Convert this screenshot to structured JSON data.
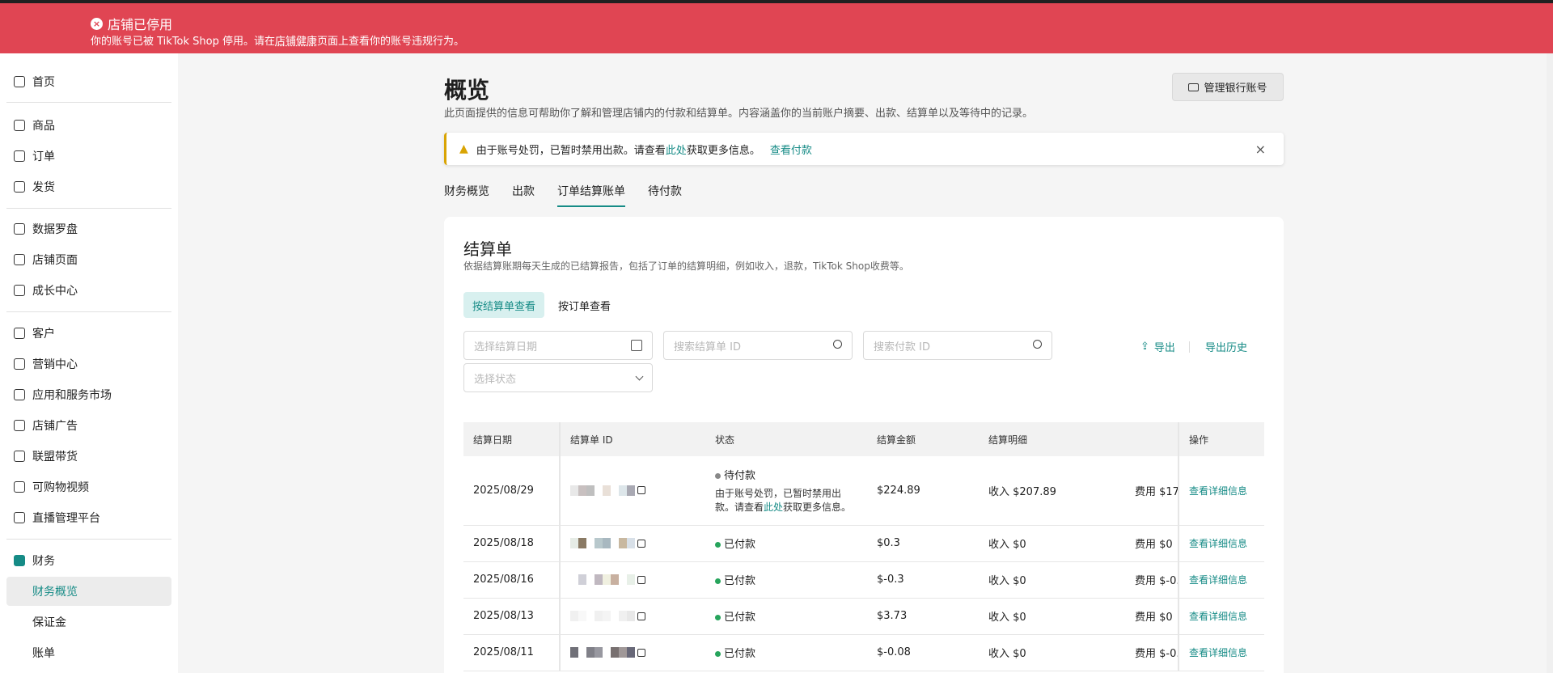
{
  "banner": {
    "title": "店铺已停用",
    "desc_prefix": "你的账号已被 TikTok Shop 停用。请在",
    "desc_link": "店铺健康",
    "desc_suffix": "页面上查看你的账号违规行为。"
  },
  "sidebar": {
    "items": [
      {
        "label": "首页",
        "icon": "home-icon"
      },
      {
        "label": "商品",
        "icon": "box-icon"
      },
      {
        "label": "订单",
        "icon": "clipboard-icon"
      },
      {
        "label": "发货",
        "icon": "truck-icon"
      },
      {
        "label": "数据罗盘",
        "icon": "compass-icon"
      },
      {
        "label": "店铺页面",
        "icon": "store-icon"
      },
      {
        "label": "成长中心",
        "icon": "medal-icon"
      },
      {
        "label": "客户",
        "icon": "users-icon"
      },
      {
        "label": "营销中心",
        "icon": "megaphone-icon"
      },
      {
        "label": "应用和服务市场",
        "icon": "apps-icon"
      },
      {
        "label": "店铺广告",
        "icon": "ad-icon"
      },
      {
        "label": "联盟带货",
        "icon": "affiliate-icon"
      },
      {
        "label": "可购物视频",
        "icon": "video-icon"
      },
      {
        "label": "直播管理平台",
        "icon": "live-icon"
      },
      {
        "label": "财务",
        "icon": "wallet-icon"
      },
      {
        "label": "财务概览",
        "icon": ""
      },
      {
        "label": "保证金",
        "icon": ""
      },
      {
        "label": "账单",
        "icon": ""
      }
    ]
  },
  "header": {
    "title": "概览",
    "desc": "此页面提供的信息可帮助你了解和管理店铺内的付款和结算单。内容涵盖你的当前账户摘要、出款、结算单以及等待中的记录。",
    "bank_button": "管理银行账号"
  },
  "alert": {
    "text_prefix": "由于账号处罚，已暂时禁用出款。请查看",
    "text_link": "此处",
    "text_suffix": "获取更多信息。",
    "action": "查看付款"
  },
  "tabs": [
    "财务概览",
    "出款",
    "订单结算账单",
    "待付款"
  ],
  "active_tab": "订单结算账单",
  "section": {
    "title": "结算单",
    "desc": "依据结算账期每天生成的已结算报告，包括了订单的结算明细，例如收入，退款，TikTok Shop收费等。",
    "view_by_statement": "按结算单查看",
    "view_by_order": "按订单查看"
  },
  "filters": {
    "date_placeholder": "选择结算日期",
    "statement_id_placeholder": "搜索结算单 ID",
    "payment_id_placeholder": "搜索付款 ID",
    "status_placeholder": "选择状态",
    "export": "导出",
    "export_history": "导出历史"
  },
  "table": {
    "headers": [
      "结算日期",
      "结算单 ID",
      "状态",
      "结算金额",
      "结算明细",
      "",
      "操作"
    ],
    "rows": [
      {
        "date": "2025/08/29",
        "status": "待付款",
        "status_color": "#888888",
        "note_prefix": "由于账号处罚，已暂时禁用出款。请查看",
        "note_link": "此处",
        "note_suffix": "获取更多信息。",
        "amount": "$224.89",
        "income": "收入 $207.89",
        "fee": "费用 $17",
        "action": "查看详细信息"
      },
      {
        "date": "2025/08/18",
        "status": "已付款",
        "status_color": "#27a45c",
        "amount": "$0.3",
        "income": "收入 $0",
        "fee": "费用 $0",
        "action": "查看详细信息"
      },
      {
        "date": "2025/08/16",
        "status": "已付款",
        "status_color": "#27a45c",
        "amount": "$-0.3",
        "income": "收入 $0",
        "fee": "费用 $-0.",
        "action": "查看详细信息"
      },
      {
        "date": "2025/08/13",
        "status": "已付款",
        "status_color": "#27a45c",
        "amount": "$3.73",
        "income": "收入 $0",
        "fee": "费用 $0",
        "action": "查看详细信息"
      },
      {
        "date": "2025/08/11",
        "status": "已付款",
        "status_color": "#27a45c",
        "amount": "$-0.08",
        "income": "收入 $0",
        "fee": "费用 $-0.",
        "action": "查看详细信息"
      }
    ]
  },
  "colors": {
    "accent": "#168b86",
    "banner": "#e04553",
    "warning": "#d9a404"
  }
}
